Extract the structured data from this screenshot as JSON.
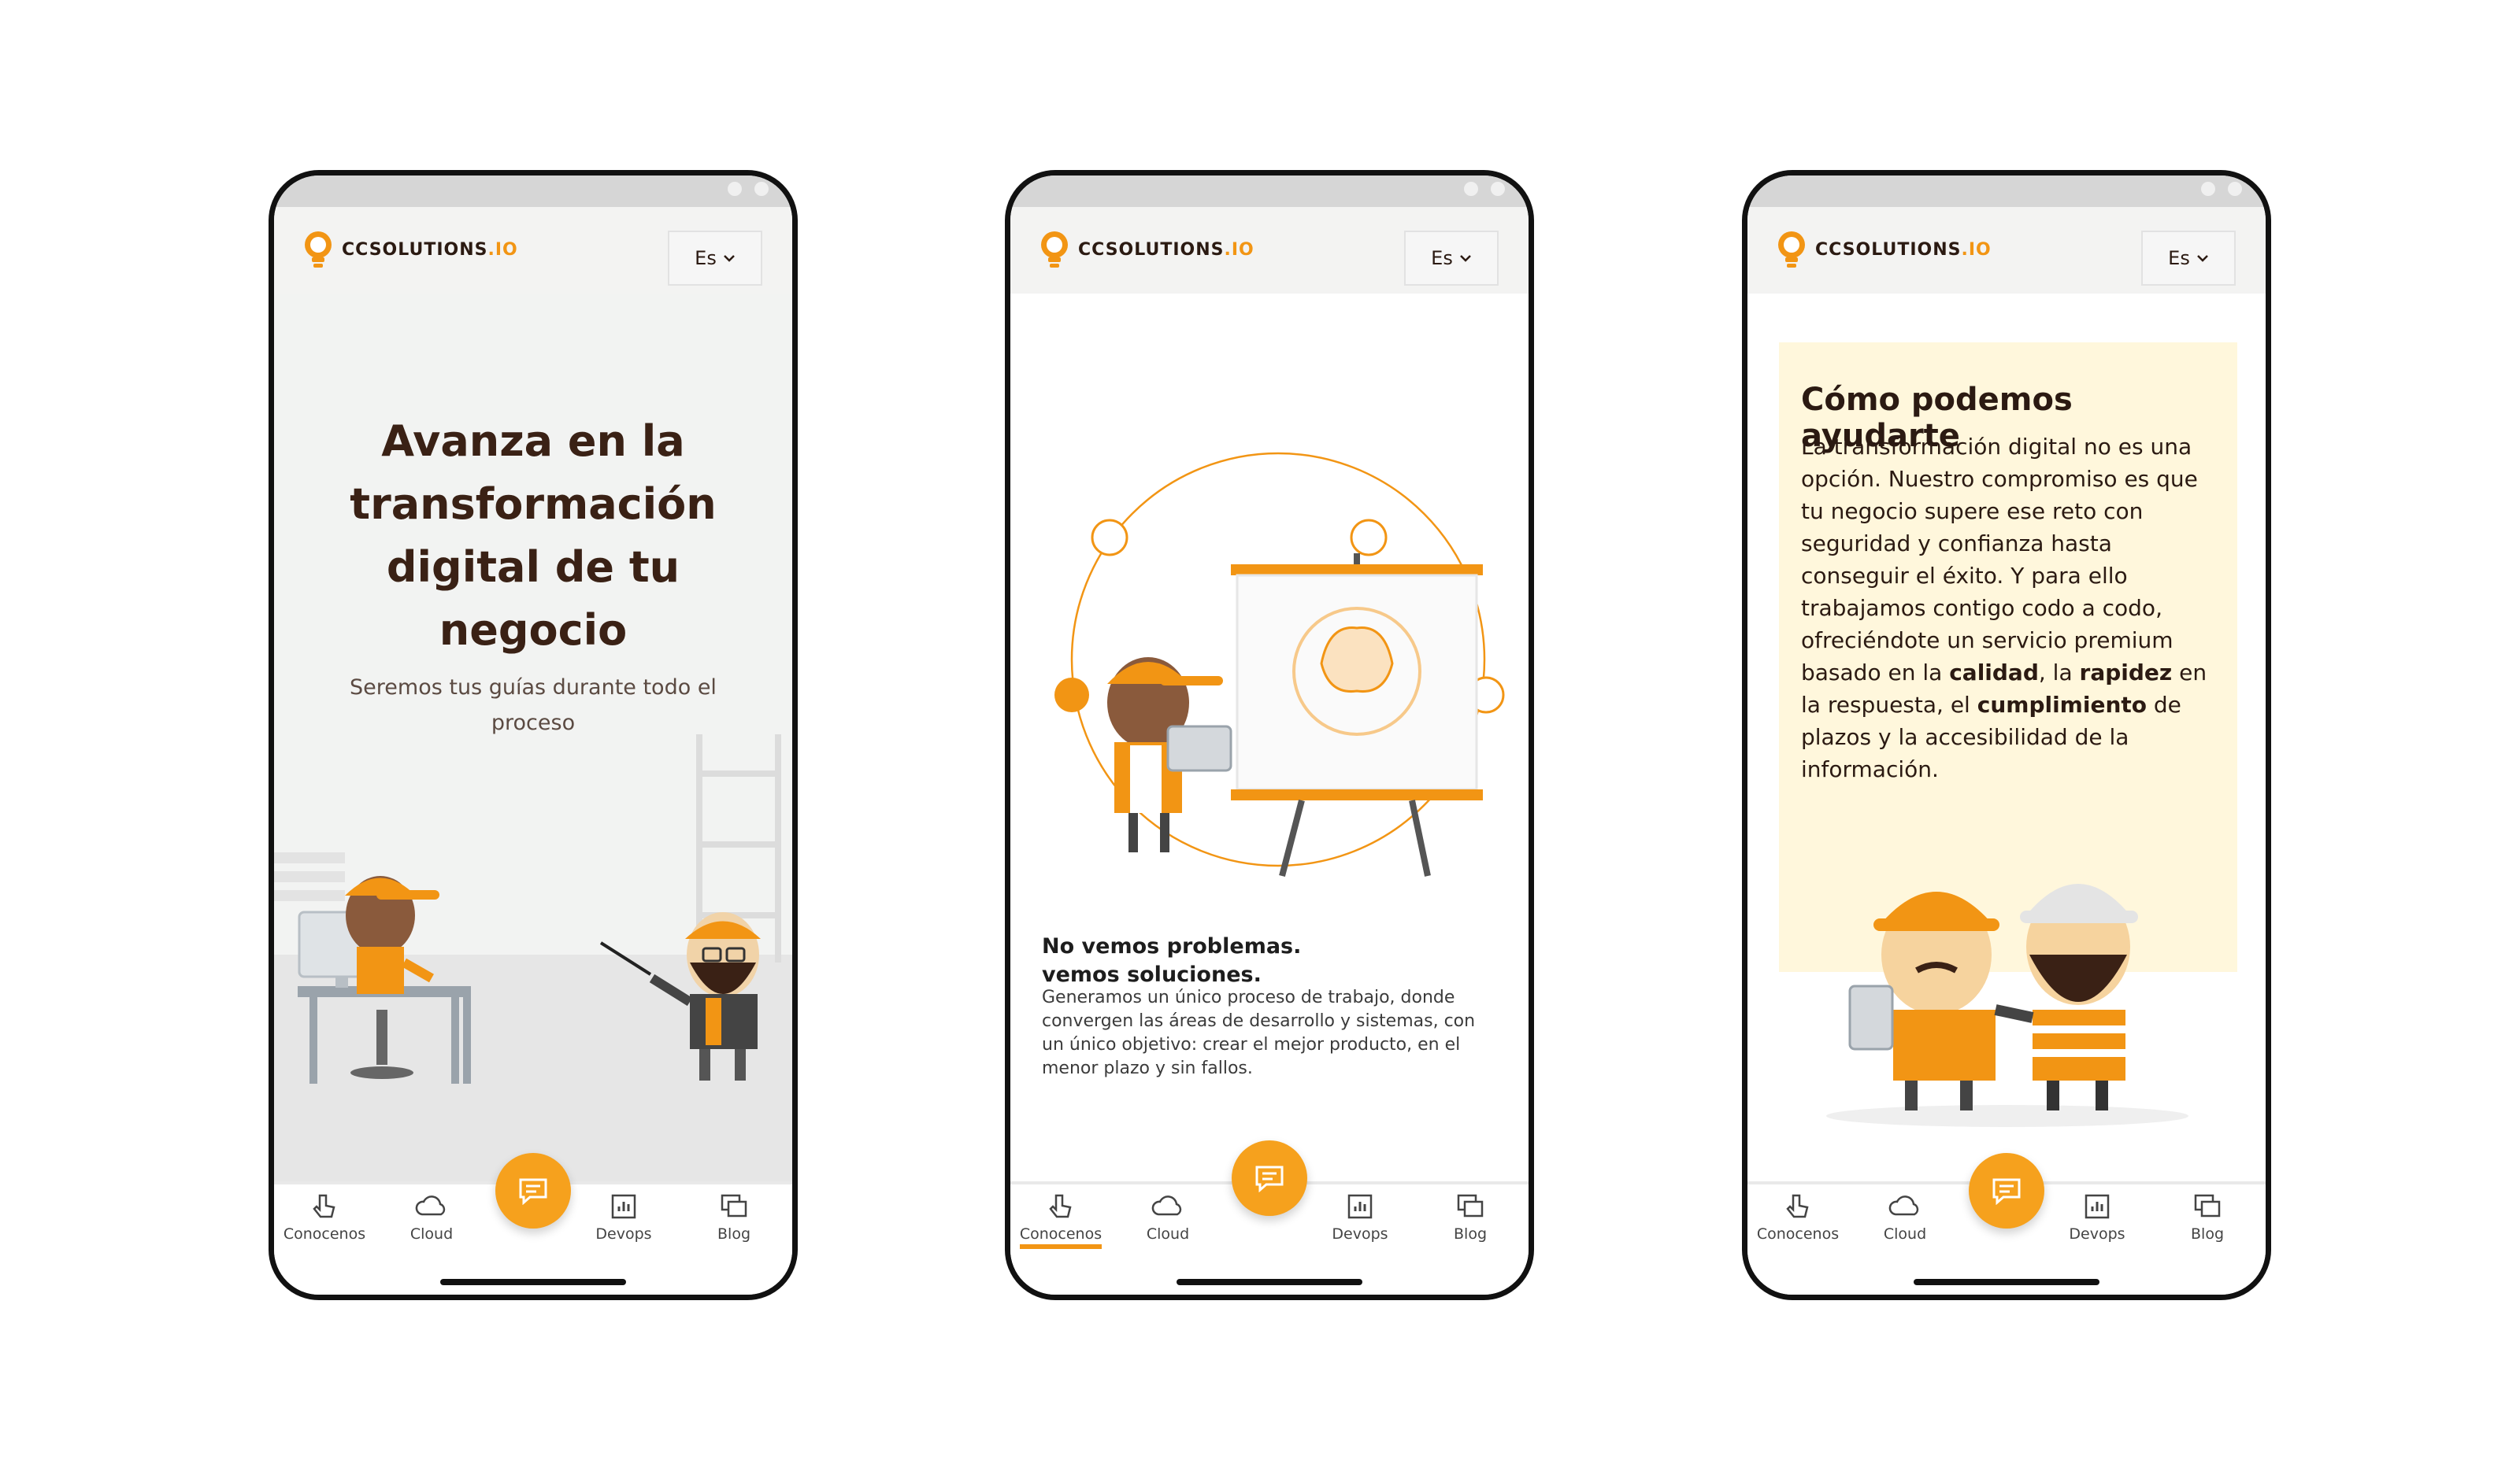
{
  "brand": {
    "name_main": "CCSOLUTIONS",
    "name_suffix": ".IO",
    "accent": "#f29514"
  },
  "header": {
    "language_label": "Es"
  },
  "tabs": [
    {
      "label": "Conocenos",
      "icon": "hand-pointer-icon"
    },
    {
      "label": "Cloud",
      "icon": "cloud-icon"
    },
    {
      "label": "Devops",
      "icon": "bar-chart-icon"
    },
    {
      "label": "Blog",
      "icon": "stacked-pages-icon"
    }
  ],
  "fab": {
    "icon": "chat-icon"
  },
  "screen1": {
    "title": "Avanza en la transformación digital de tu negocio",
    "subtitle": "Seremos tus guías durante todo el proceso"
  },
  "screen2": {
    "active_tab": "Conocenos",
    "title_line1": "No vemos problemas.",
    "title_line2": "vemos soluciones.",
    "body": "Generamos un único proceso de trabajo, donde convergen las áreas de desarrollo y sistemas, con un único objetivo: crear el mejor producto, en el menor plazo y sin fallos."
  },
  "screen3": {
    "title": "Cómo podemos ayudarte",
    "body_part1": "La transformación digital no es una opción. Nuestro compromiso es que tu negocio supere ese reto con seguridad y confianza hasta conseguir el éxito. Y para ello trabajamos contigo codo a codo, ofreciéndote un servicio premium basado en la ",
    "bold1": "calidad",
    "body_part2": ", la ",
    "bold2": "rapidez",
    "body_part3": " en la respuesta, el ",
    "bold3": "cumplimiento",
    "body_part4": " de plazos y la accesibilidad de la información."
  }
}
